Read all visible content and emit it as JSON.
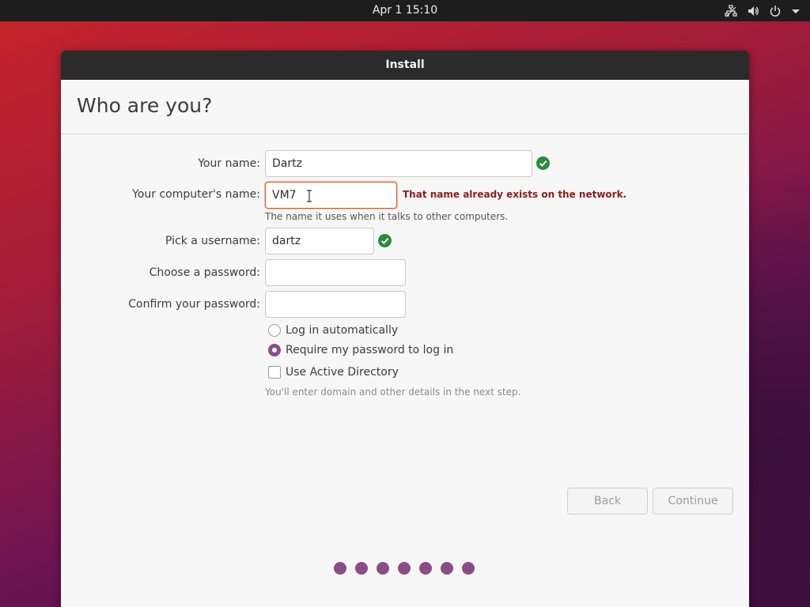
{
  "topbar": {
    "clock": "Apr 1  15:10",
    "icons": [
      "network-icon",
      "volume-icon",
      "power-icon",
      "menu-arrow-icon"
    ]
  },
  "window": {
    "title": "Install"
  },
  "page": {
    "heading": "Who are you?"
  },
  "form": {
    "name_label": "Your name:",
    "name_value": "Dartz",
    "computer_label": "Your computer's name:",
    "computer_value": "VM7",
    "computer_error": "That name already exists on the network.",
    "computer_hint": "The name it uses when it talks to other computers.",
    "username_label": "Pick a username:",
    "username_value": "dartz",
    "password_label": "Choose a password:",
    "password_value": "",
    "confirm_label": "Confirm your password:",
    "confirm_value": "",
    "login_auto_label": "Log in automatically",
    "login_auto_selected": false,
    "login_password_label": "Require my password to log in",
    "login_password_selected": true,
    "ad_label": "Use Active Directory",
    "ad_checked": false,
    "ad_hint": "You'll enter domain and other details in the next step."
  },
  "buttons": {
    "back": "Back",
    "continue": "Continue"
  },
  "progress": {
    "total_steps": 7
  },
  "colors": {
    "accent": "#8a4d86",
    "error": "#8b1d1d",
    "valid": "#2a8a3e",
    "focus": "#e95420"
  }
}
